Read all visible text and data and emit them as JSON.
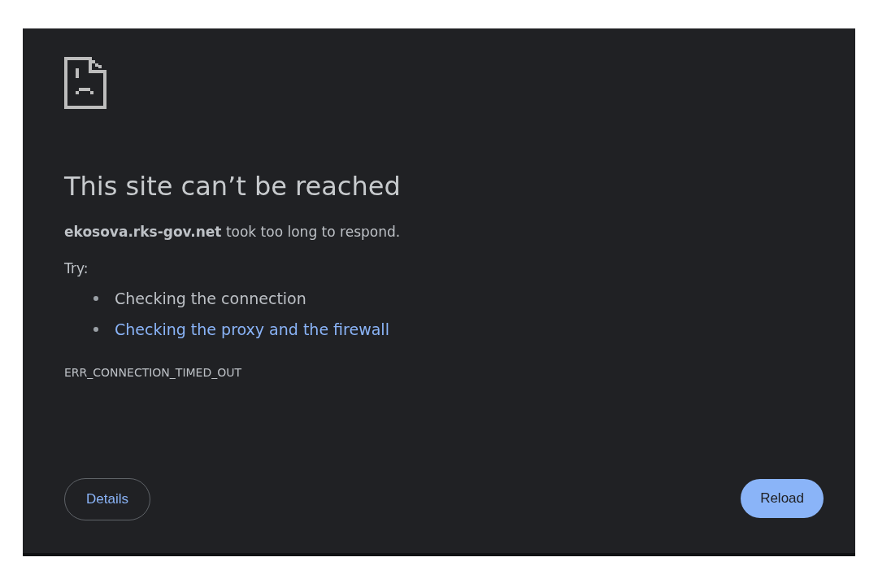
{
  "title": "This site can’t be reached",
  "message": "**ekosova.rks-gov.net** took too long to respond.",
  "try_label": "Try:",
  "suggestions": [
    {
      "text": "Checking the connection",
      "kind": "plain"
    },
    {
      "text": "Checking the proxy and the firewall",
      "kind": "link"
    }
  ],
  "error_code": "ERR_CONNECTION_TIMED_OUT",
  "buttons": [
    {
      "label": "Details",
      "kind": "outline"
    },
    {
      "label": "Reload",
      "kind": "primary"
    }
  ]
}
